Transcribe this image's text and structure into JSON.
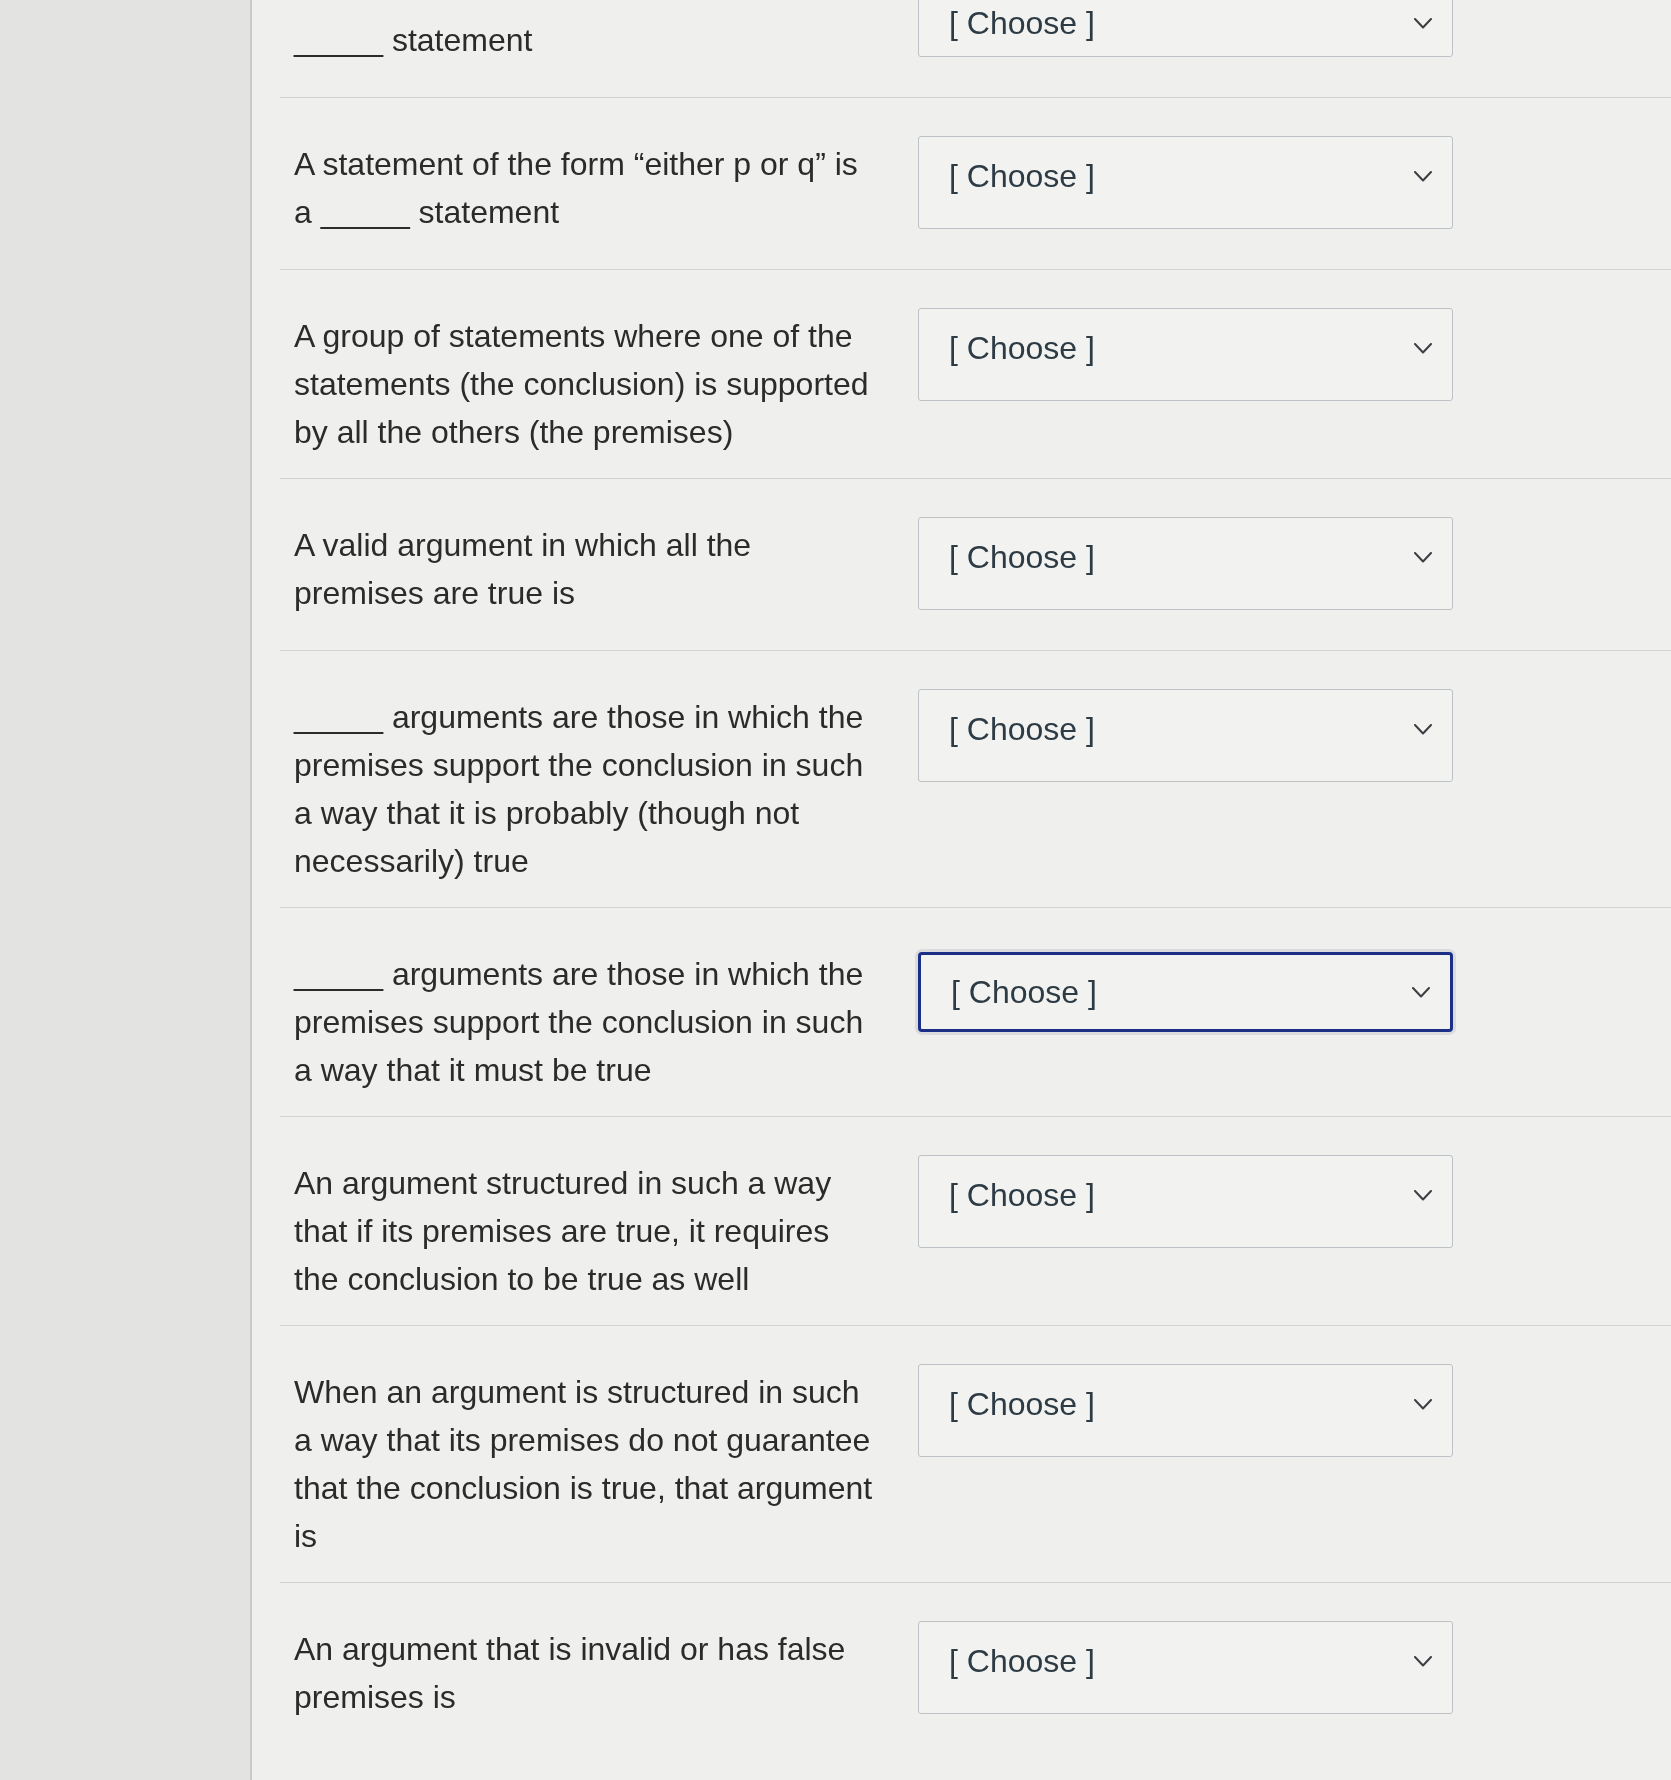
{
  "questions": [
    {
      "prompt": "_____ statement",
      "answer": {
        "value": "[ Choose ]",
        "focused": false
      }
    },
    {
      "prompt": "A statement of the form “either p or q” is a _____ statement",
      "answer": {
        "value": "[ Choose ]",
        "focused": false
      }
    },
    {
      "prompt": "A group of statements where one of the statements (the conclusion) is supported by all the others (the premises)",
      "answer": {
        "value": "[ Choose ]",
        "focused": false
      }
    },
    {
      "prompt": "A valid argument in which all the premises are true is",
      "answer": {
        "value": "[ Choose ]",
        "focused": false
      }
    },
    {
      "prompt": "_____ arguments are those in which the premises support the conclusion in such a way that it is probably (though not necessarily) true",
      "answer": {
        "value": "[ Choose ]",
        "focused": false
      }
    },
    {
      "prompt": "_____ arguments are those in which the premises support the conclusion in such a way that it must be true",
      "answer": {
        "value": "[ Choose ]",
        "focused": true
      }
    },
    {
      "prompt": "An argument structured in such a way that if its premises are true, it requires the conclusion to be true as well",
      "answer": {
        "value": "[ Choose ]",
        "focused": false
      }
    },
    {
      "prompt": "When an argument is structured in such a way that its premises do not guarantee that the conclusion is true, that argument is",
      "answer": {
        "value": "[ Choose ]",
        "focused": false
      }
    },
    {
      "prompt": "An argument that is invalid or has false premises is",
      "answer": {
        "value": "[ Choose ]",
        "focused": false
      }
    }
  ]
}
